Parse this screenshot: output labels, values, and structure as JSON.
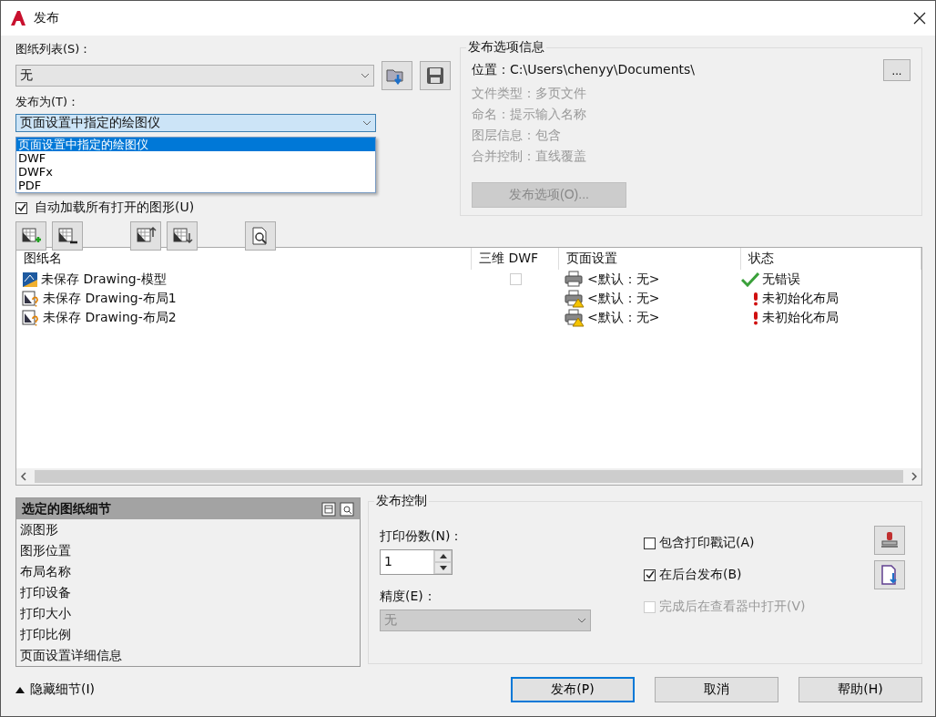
{
  "window": {
    "title": "发布"
  },
  "sheet_list": {
    "label": "图纸列表(S)：",
    "value": "无"
  },
  "publish_to": {
    "label": "发布为(T)：",
    "value": "页面设置中指定的绘图仪",
    "expanded": true,
    "options": [
      {
        "label": "页面设置中指定的绘图仪",
        "selected": true
      },
      {
        "label": "DWF",
        "selected": false
      },
      {
        "label": "DWFx",
        "selected": false
      },
      {
        "label": "PDF",
        "selected": false
      }
    ]
  },
  "auto_load": {
    "label": "自动加载所有打开的图形(U)",
    "checked": true
  },
  "options_info": {
    "title": "发布选项信息",
    "location": "位置：C:\\Users\\chenyy\\Documents\\",
    "browse": "...",
    "lines": [
      "文件类型：多页文件",
      "命名：提示输入名称",
      "图层信息：包含",
      "合并控制：直线覆盖"
    ],
    "button": "发布选项(O)..."
  },
  "table": {
    "columns": [
      "图纸名",
      "三维 DWF",
      "页面设置",
      "状态"
    ],
    "rows": [
      {
        "kind": "model",
        "name": "未保存 Drawing-模型",
        "dwf_3d": {
          "checked": false
        },
        "page_setup": {
          "text": "<默认：无>",
          "warning": false
        },
        "status": {
          "kind": "ok",
          "text": "无错误"
        }
      },
      {
        "kind": "layout",
        "name": "未保存 Drawing-布局1",
        "page_setup": {
          "text": "<默认：无>",
          "warning": true
        },
        "status": {
          "kind": "error",
          "text": "未初始化布局"
        }
      },
      {
        "kind": "layout",
        "name": "未保存 Drawing-布局2",
        "page_setup": {
          "text": "<默认：无>",
          "warning": true
        },
        "status": {
          "kind": "error",
          "text": "未初始化布局"
        }
      }
    ]
  },
  "details": {
    "title": "选定的图纸细节",
    "items": [
      "源图形",
      "图形位置",
      "布局名称",
      "打印设备",
      "打印大小",
      "打印比例",
      "页面设置详细信息"
    ]
  },
  "publish_control": {
    "title": "发布控制",
    "copies_label": "打印份数(N)：",
    "copies": "1",
    "precision_label": "精度(E)：",
    "precision": "无",
    "checkboxes": [
      {
        "label": "包含打印戳记(A)",
        "checked": false,
        "disabled": false
      },
      {
        "label": "在后台发布(B)",
        "checked": true,
        "disabled": false
      },
      {
        "label": "完成后在查看器中打开(V)",
        "checked": false,
        "disabled": true
      }
    ]
  },
  "footer": {
    "toggle": "隐藏细节(I)",
    "buttons": [
      {
        "label": "发布(P)",
        "default": true
      },
      {
        "label": "取消",
        "default": false
      },
      {
        "label": "帮助(H)",
        "default": false
      }
    ]
  }
}
